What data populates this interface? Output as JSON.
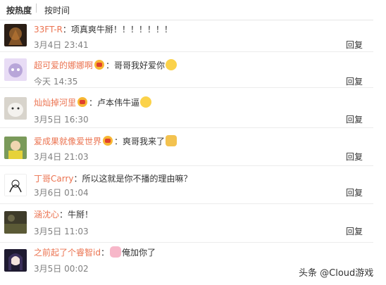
{
  "sort": {
    "hot": "按热度",
    "time": "按时间"
  },
  "reply_label": "回复",
  "comments": [
    {
      "name": "33FT-R",
      "sep": "：",
      "text": "项真爽牛掰！！！！！！！",
      "time": "3月4日 23:41",
      "avatar": "#3a2a1e"
    },
    {
      "name": "超可爱的娜娜啊",
      "sep": "：",
      "text": "哥哥我好爱你",
      "time": "今天 14:35",
      "avatar": "#b8a6d9"
    },
    {
      "name": "灿灿掉河里",
      "sep": "：",
      "text": "卢本伟牛逼",
      "time": "3月5日 16:30",
      "avatar": "#c9c4bb"
    },
    {
      "name": "爱成果就像爱世界",
      "sep": "：",
      "text": "爽哥我来了",
      "time": "3月4日 21:03",
      "avatar": "#d9c24a"
    },
    {
      "name": "丁哥Carry",
      "sep": "：",
      "text": "所以这就是你不播的理由嘛？",
      "time": "3月6日 01:04",
      "avatar": "#f2f2f2"
    },
    {
      "name": "涵沈心",
      "sep": "：",
      "text": "牛掰！",
      "time": "3月5日 11:03",
      "avatar": "#4a4a32"
    },
    {
      "name": "之前起了个睿智id",
      "sep": "：",
      "text": "俺加你了",
      "time": "3月5日 00:02",
      "avatar": "#2b2540"
    }
  ],
  "watermark": "头条 @Cloud游戏"
}
